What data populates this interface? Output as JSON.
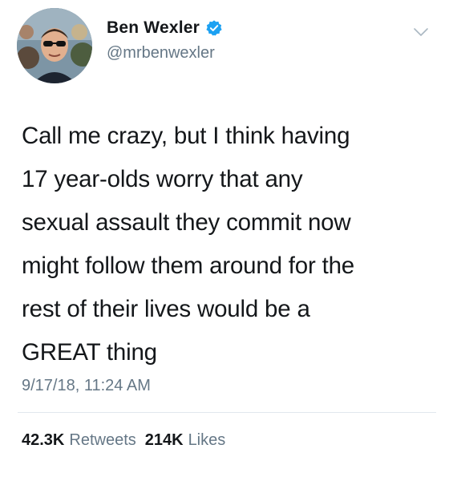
{
  "author": {
    "display_name": "Ben Wexler",
    "handle": "@mrbenwexler",
    "verified": true
  },
  "tweet": {
    "text": "Call me crazy, but I think having\n17 year-olds worry that any\nsexual assault they commit now\nmight follow them around for the\nrest of their lives would be a\nGREAT thing",
    "timestamp": "9/17/18, 11:24 AM"
  },
  "stats": {
    "retweets_count": "42.3K",
    "retweets_label": "Retweets",
    "likes_count": "214K",
    "likes_label": "Likes"
  },
  "colors": {
    "verified_blue": "#1da1f2",
    "secondary_text": "#657786",
    "primary_text": "#14171a",
    "divider": "#e1e8ed"
  },
  "icons": {
    "verified": "verified-badge-icon",
    "menu": "chevron-down-icon"
  }
}
